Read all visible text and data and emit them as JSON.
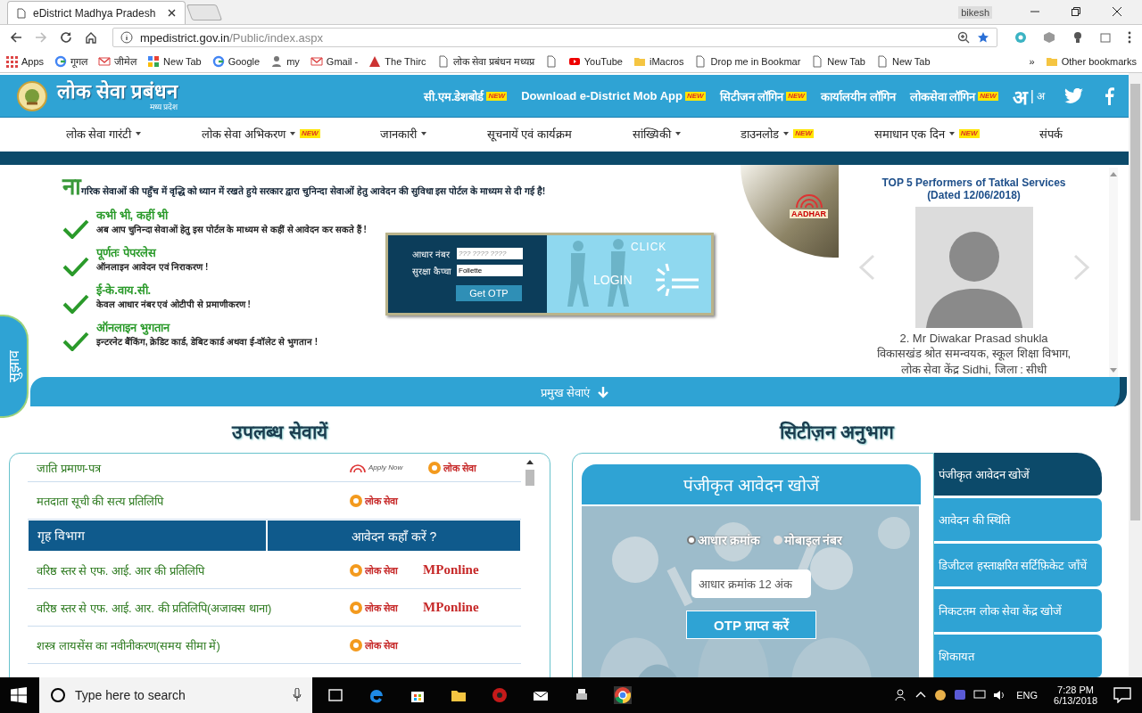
{
  "browser": {
    "tab_title": "eDistrict Madhya Pradesh",
    "user": "bikesh",
    "address_host": "mpedistrict.gov.in",
    "address_path": "/Public/index.aspx",
    "bookmarks": [
      {
        "label": "Apps",
        "kind": "apps"
      },
      {
        "label": "गूगल",
        "kind": "google"
      },
      {
        "label": "जीमेल",
        "kind": "gmail"
      },
      {
        "label": "New Tab",
        "kind": "grid"
      },
      {
        "label": "Google",
        "kind": "google"
      },
      {
        "label": "my",
        "kind": "figure"
      },
      {
        "label": "Gmail -",
        "kind": "gmail"
      },
      {
        "label": "The Thirc",
        "kind": "triangle"
      },
      {
        "label": "लोक सेवा प्रबंधन मध्यप्र",
        "kind": "page"
      },
      {
        "kind": "page"
      },
      {
        "label": "YouTube",
        "kind": "youtube"
      },
      {
        "label": "iMacros",
        "kind": "folder"
      },
      {
        "label": "Drop me in Bookmar",
        "kind": "page"
      },
      {
        "label": "New Tab",
        "kind": "page"
      },
      {
        "label": "New Tab",
        "kind": "page"
      }
    ],
    "more": "»",
    "other": "Other bookmarks"
  },
  "header": {
    "logo_title": "लोक सेवा प्रबंधन",
    "logo_subtitle": "मध्य प्रदेश",
    "links": [
      {
        "label": "सी.एम.डेशबोर्ड",
        "badge": "NEW"
      },
      {
        "label": "Download e-District Mob App",
        "badge": "NEW"
      },
      {
        "label": "सिटीजन लॉगिन",
        "badge": "NEW"
      },
      {
        "label": "कार्यालयीन लॉगिन"
      },
      {
        "label": "लोकसेवा लॉगिन",
        "badge": "NEW"
      }
    ],
    "font_big": "अ",
    "font_sep": "|",
    "font_small": "अ"
  },
  "nav": [
    {
      "label": "लोक सेवा गारंटी",
      "dropdown": true
    },
    {
      "label": "लोक सेवा अभिकरण",
      "dropdown": true,
      "badge": "NEW"
    },
    {
      "label": "जानकारी",
      "dropdown": true
    },
    {
      "label": "सूचनायें एवं कार्यक्रम",
      "dropdown": false
    },
    {
      "label": "सांख्यिकी",
      "dropdown": true
    },
    {
      "label": "डाउनलोड",
      "dropdown": true,
      "badge": "NEW"
    },
    {
      "label": "समाधान एक दिन",
      "dropdown": true,
      "badge": "NEW"
    },
    {
      "label": "संपर्क",
      "dropdown": false
    }
  ],
  "hero": {
    "intro": "नागरिक सेवाओं की पहुँच में वृद्धि को ध्यान में रखते हुये सरकार द्वारा चुनिन्दा सेवाओं हेतु आवेदन की सुविधा इस पोर्टल के माध्यम से दी गई है!",
    "features": [
      {
        "title": "कभी भी, कहीं भी",
        "text": "अब आप चुनिन्दा सेवाओं हेतु इस पोर्टल के माध्यम से कहीं से आवेदन कर सकते हैं !"
      },
      {
        "title": "पूर्णतः पेपरलेस",
        "text": "ऑनलाइन आवेदन एवं निराकरण !"
      },
      {
        "title": "ई-के.वाय.सी.",
        "text": "केवल आधार नंबर एवं ओटीपी से प्रमाणीकरण !"
      },
      {
        "title": "ऑनलाइन भुगतान",
        "text": "इन्टरनेट बैंकिंग, क्रेडिट कार्ड, डेबिट कार्ड अथवा ई-वॉलेट से भुगतान !"
      }
    ],
    "login": {
      "aadhaar_label": "आधार नंबर",
      "aadhaar_placeholder": "??? ???? ????",
      "captcha_label": "सुरक्षा कैप्चा",
      "captcha_value": "Follette",
      "button": "Get OTP",
      "click": "CLICK",
      "login": "LOGIN"
    },
    "aadhaar_badge": "AADHAR",
    "performers": {
      "title": "TOP 5 Performers of Tatkal Services",
      "date": "(Dated 12/06/2018)",
      "name": "2. Mr Diwakar Prasad shukla",
      "lines": [
        "विकासखंड श्रोत समन्वयक, स्कूल शिक्षा विभाग,",
        "लोक सेवा केंद्र Sidhi, जिला : सीधी"
      ]
    }
  },
  "feedback_tab": "सुझाव",
  "services_bar": "प्रमुख सेवाएं",
  "services": {
    "heading": "उपलब्ध सेवायें",
    "rows": [
      {
        "kind": "service",
        "name": "जाति प्रमाण-पत्र",
        "logos": [
          {
            "kind": "aadhaar",
            "text": "Apply Now"
          },
          {
            "kind": "lokseva",
            "text": "लोक सेवा"
          }
        ]
      },
      {
        "kind": "service",
        "name": "मतदाता सूची की सत्य प्रतिलिपि",
        "logos": [
          {
            "kind": "lokseva",
            "text": "लोक सेवा"
          }
        ]
      },
      {
        "kind": "header",
        "cells": [
          "गृह विभाग",
          "आवेदन कहाँ करें ?"
        ]
      },
      {
        "kind": "service",
        "name": "वरिष्ठ स्तर से एफ. आई. आर की प्रतिलिपि",
        "logos": [
          {
            "kind": "lokseva",
            "text": "लोक सेवा"
          },
          {
            "kind": "mponline",
            "text": "MPonline"
          }
        ]
      },
      {
        "kind": "service",
        "name": "वरिष्ठ स्तर से एफ. आई. आर. की प्रतिलिपि(अजाक्स थाना)",
        "logos": [
          {
            "kind": "lokseva",
            "text": "लोक सेवा"
          },
          {
            "kind": "mponline",
            "text": "MPonline"
          }
        ]
      },
      {
        "kind": "service",
        "name": "शस्त्र लायसेंस का नवीनीकरण(समय सीमा में)",
        "logos": [
          {
            "kind": "lokseva",
            "text": "लोक सेवा"
          }
        ]
      }
    ]
  },
  "citizen": {
    "heading": "सिटीज़न अनुभाग",
    "panel_title": "पंजीकृत आवेदन खोजें",
    "radios": [
      {
        "label": "आधार क्रमांक",
        "selected": true
      },
      {
        "label": "मोबाइल नंबर",
        "selected": false
      }
    ],
    "placeholder": "आधार क्रमांक 12 अंक",
    "button": "OTP प्राप्त करें",
    "tabs": [
      {
        "label": "पंजीकृत आवेदन खोजें",
        "selected": true
      },
      {
        "label": "आवेदन की स्थिति",
        "selected": false
      },
      {
        "label": "डिजीटल हस्ताक्षरित सर्टिफ़िकेट जाँचें",
        "selected": false
      },
      {
        "label": "निकटतम लोक सेवा केंद्र खोजें",
        "selected": false
      },
      {
        "label": "शिकायत",
        "selected": false
      }
    ]
  },
  "taskbar": {
    "search_placeholder": "Type here to search",
    "language": "ENG",
    "time": "7:28 PM",
    "date": "6/13/2018"
  }
}
